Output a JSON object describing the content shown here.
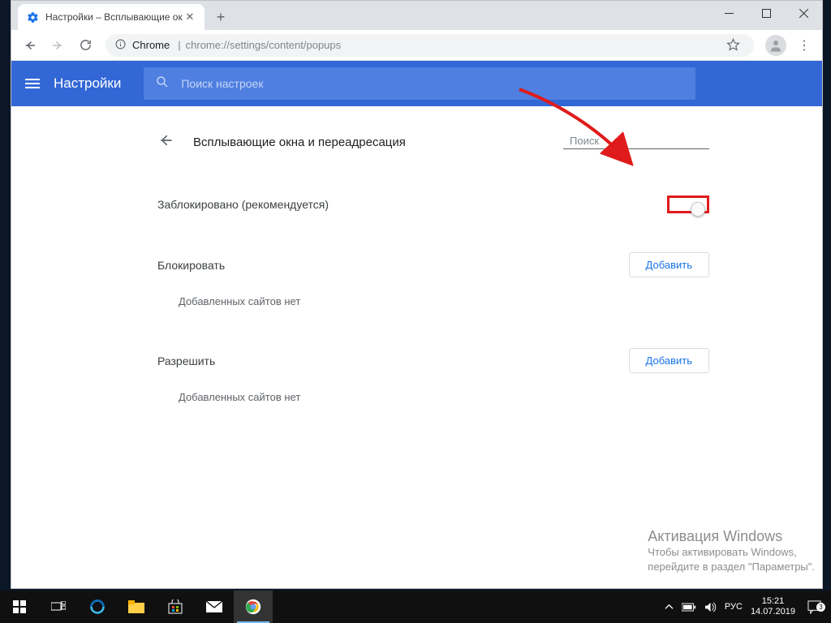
{
  "window": {
    "tab_title": "Настройки – Всплывающие ок",
    "omnibox_prefix": "Chrome",
    "omnibox_url": "chrome://settings/content/popups"
  },
  "settings": {
    "app_title": "Настройки",
    "search_placeholder": "Поиск настроек",
    "page": {
      "title": "Всплывающие окна и переадресация",
      "search_placeholder": "Поиск",
      "blocked_label": "Заблокировано (рекомендуется)",
      "block_section": "Блокировать",
      "allow_section": "Разрешить",
      "add_button": "Добавить",
      "empty_list": "Добавленных сайтов нет"
    }
  },
  "watermark": {
    "line1": "Активация Windows",
    "line2": "Чтобы активировать Windows,",
    "line3": "перейдите в раздел \"Параметры\"."
  },
  "taskbar": {
    "lang": "РУС",
    "time": "15:21",
    "date": "14.07.2019",
    "notif_count": "3"
  }
}
